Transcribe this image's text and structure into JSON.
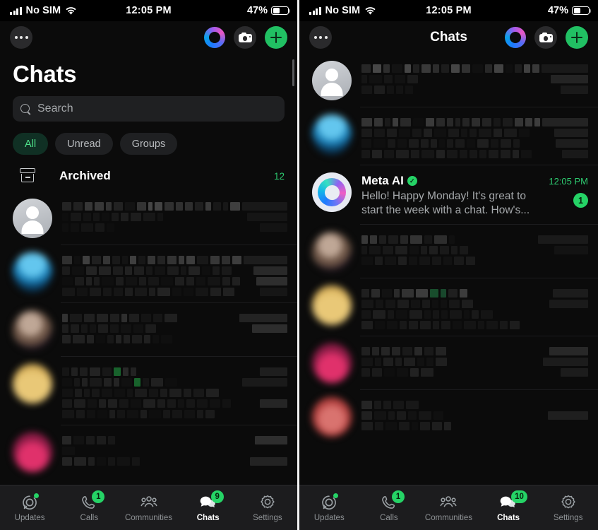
{
  "status_bar": {
    "carrier": "No SIM",
    "time": "12:05 PM",
    "battery_percent": "47%",
    "battery_level": 47,
    "signal_icon": "signal-bars-icon",
    "wifi_icon": "wifi-icon",
    "battery_icon": "battery-icon"
  },
  "left_panel": {
    "nav": {
      "more_icon": "more-dots-icon",
      "meta_ai_icon": "meta-ai-ring-icon",
      "camera_icon": "camera-icon",
      "new_chat_icon": "plus-icon"
    },
    "title": "Chats",
    "search": {
      "placeholder": "Search",
      "icon": "search-icon"
    },
    "filters": [
      {
        "label": "All",
        "active": true
      },
      {
        "label": "Unread",
        "active": false
      },
      {
        "label": "Groups",
        "active": false
      }
    ],
    "archived": {
      "icon": "archive-box-icon",
      "label": "Archived",
      "count": "12"
    },
    "rows": [
      {
        "avatar": "av-default",
        "redacted": true
      },
      {
        "avatar": "av-a",
        "redacted": true
      },
      {
        "avatar": "av-b",
        "redacted": true
      },
      {
        "avatar": "av-c",
        "redacted": true
      },
      {
        "avatar": "av-d",
        "redacted": true
      }
    ],
    "tabs": [
      {
        "label": "Updates",
        "icon": "updates-icon",
        "badge": "",
        "dot": true,
        "active": false
      },
      {
        "label": "Calls",
        "icon": "phone-icon",
        "badge": "1",
        "dot": false,
        "active": false
      },
      {
        "label": "Communities",
        "icon": "communities-icon",
        "badge": "",
        "dot": false,
        "active": false
      },
      {
        "label": "Chats",
        "icon": "chats-bubble-icon",
        "badge": "9",
        "dot": false,
        "active": true
      },
      {
        "label": "Settings",
        "icon": "gear-icon",
        "badge": "",
        "dot": false,
        "active": false
      }
    ]
  },
  "right_panel": {
    "nav": {
      "more_icon": "more-dots-icon",
      "title": "Chats",
      "meta_ai_icon": "meta-ai-ring-icon",
      "camera_icon": "camera-icon",
      "new_chat_icon": "plus-icon"
    },
    "rows": [
      {
        "avatar": "av-default",
        "redacted": true
      },
      {
        "avatar": "av-a",
        "redacted": true
      },
      {
        "avatar": "av-ring",
        "redacted": false,
        "name": "Meta AI",
        "verified": true,
        "verified_glyph": "✓",
        "time": "12:05 PM",
        "time_unread": true,
        "preview": "Hello! Happy Monday! It's great to start the week with a chat. How's...",
        "badge": "1"
      },
      {
        "avatar": "av-b",
        "redacted": true
      },
      {
        "avatar": "av-c",
        "redacted": true
      },
      {
        "avatar": "av-d",
        "redacted": true
      },
      {
        "avatar": "av-e",
        "redacted": true
      }
    ],
    "tabs": [
      {
        "label": "Updates",
        "icon": "updates-icon",
        "badge": "",
        "dot": true,
        "active": false
      },
      {
        "label": "Calls",
        "icon": "phone-icon",
        "badge": "1",
        "dot": false,
        "active": false
      },
      {
        "label": "Communities",
        "icon": "communities-icon",
        "badge": "",
        "dot": false,
        "active": false
      },
      {
        "label": "Chats",
        "icon": "chats-bubble-icon",
        "badge": "10",
        "dot": false,
        "active": true
      },
      {
        "label": "Settings",
        "icon": "gear-icon",
        "badge": "",
        "dot": false,
        "active": false
      }
    ]
  },
  "colors": {
    "accent_green": "#25d366",
    "badge_green": "#2ecc71",
    "pill_active_bg": "#103024",
    "pill_active_text": "#4fe08a",
    "background": "#0b0b0b",
    "tabbar_bg": "#1c1c1e",
    "divider": "#f2f2f2"
  }
}
